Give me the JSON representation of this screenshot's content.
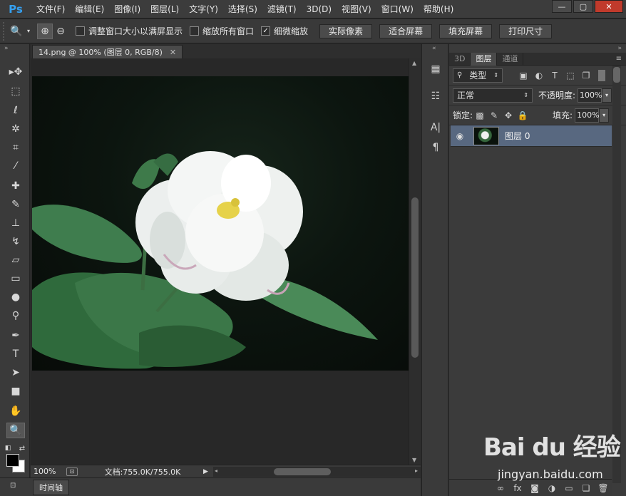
{
  "app": {
    "logo": "Ps"
  },
  "menu": [
    "文件(F)",
    "编辑(E)",
    "图像(I)",
    "图层(L)",
    "文字(Y)",
    "选择(S)",
    "滤镜(T)",
    "3D(D)",
    "视图(V)",
    "窗口(W)",
    "帮助(H)"
  ],
  "options": {
    "checkbox_resize": "调整窗口大小以满屏显示",
    "checkbox_resize_checked": false,
    "checkbox_zoom_all": "缩放所有窗口",
    "checkbox_zoom_all_checked": false,
    "checkbox_scrubby": "细微缩放",
    "checkbox_scrubby_checked": true,
    "btn_actual": "实际像素",
    "btn_fit": "适合屏幕",
    "btn_fill": "填充屏幕",
    "btn_print": "打印尺寸"
  },
  "document": {
    "tab_title": "14.png @ 100% (图层 0, RGB/8)",
    "zoom": "100%",
    "info": "文档:755.0K/755.0K"
  },
  "timeline": {
    "label": "时间轴"
  },
  "panel": {
    "tabs": [
      "3D",
      "图层",
      "通道"
    ],
    "active_tab": "图层",
    "filter_kind": "类型",
    "blend_mode": "正常",
    "opacity_label": "不透明度:",
    "opacity_value": "100%",
    "lock_label": "锁定:",
    "fill_label": "填充:",
    "fill_value": "100%",
    "layer_name": "图层 0"
  },
  "watermark": {
    "logo": "Bai du 经验",
    "url": "jingyan.baidu.com"
  }
}
